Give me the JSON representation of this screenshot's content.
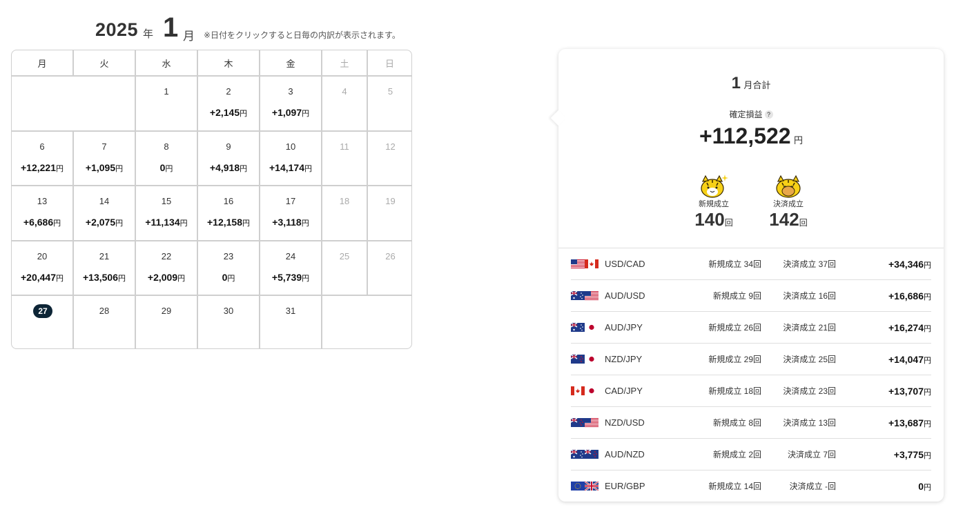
{
  "calendar": {
    "year": "2025",
    "year_unit": "年",
    "month": "1",
    "month_unit": "月",
    "note": "※日付をクリックすると日毎の内訳が表示されます。",
    "weekdays": [
      "月",
      "火",
      "水",
      "木",
      "金",
      "土",
      "日"
    ],
    "currency_unit": "円",
    "weeks": [
      [
        {
          "day": "",
          "pl": ""
        },
        {
          "day": "",
          "pl": ""
        },
        {
          "day": "1",
          "pl": ""
        },
        {
          "day": "2",
          "pl": "+2,145"
        },
        {
          "day": "3",
          "pl": "+1,097"
        },
        {
          "day": "4",
          "pl": ""
        },
        {
          "day": "5",
          "pl": ""
        }
      ],
      [
        {
          "day": "6",
          "pl": "+12,221"
        },
        {
          "day": "7",
          "pl": "+1,095"
        },
        {
          "day": "8",
          "pl": "0"
        },
        {
          "day": "9",
          "pl": "+4,918"
        },
        {
          "day": "10",
          "pl": "+14,174"
        },
        {
          "day": "11",
          "pl": ""
        },
        {
          "day": "12",
          "pl": ""
        }
      ],
      [
        {
          "day": "13",
          "pl": "+6,686"
        },
        {
          "day": "14",
          "pl": "+2,075"
        },
        {
          "day": "15",
          "pl": "+11,134"
        },
        {
          "day": "16",
          "pl": "+12,158"
        },
        {
          "day": "17",
          "pl": "+3,118"
        },
        {
          "day": "18",
          "pl": ""
        },
        {
          "day": "19",
          "pl": ""
        }
      ],
      [
        {
          "day": "20",
          "pl": "+20,447"
        },
        {
          "day": "21",
          "pl": "+13,506"
        },
        {
          "day": "22",
          "pl": "+2,009"
        },
        {
          "day": "23",
          "pl": "0"
        },
        {
          "day": "24",
          "pl": "+5,739"
        },
        {
          "day": "25",
          "pl": ""
        },
        {
          "day": "26",
          "pl": ""
        }
      ],
      [
        {
          "day": "27",
          "pl": "",
          "today": true
        },
        {
          "day": "28",
          "pl": ""
        },
        {
          "day": "29",
          "pl": ""
        },
        {
          "day": "30",
          "pl": ""
        },
        {
          "day": "31",
          "pl": ""
        },
        {
          "day": "",
          "pl": ""
        },
        {
          "day": "",
          "pl": ""
        }
      ]
    ]
  },
  "summary": {
    "month": "1",
    "title_suffix": "月合計",
    "realized_label": "確定損益",
    "help_glyph": "?",
    "total": "+112,522",
    "unit": "円",
    "open_label": "新規成立",
    "open_count": "140",
    "close_label": "決済成立",
    "close_count": "142",
    "count_unit": "回",
    "pairs": [
      {
        "name": "USD/CAD",
        "flags": [
          "us",
          "ca"
        ],
        "open": "新規成立 34回",
        "close": "決済成立 37回",
        "pl": "+34,346"
      },
      {
        "name": "AUD/USD",
        "flags": [
          "au",
          "us"
        ],
        "open": "新規成立 9回",
        "close": "決済成立 16回",
        "pl": "+16,686"
      },
      {
        "name": "AUD/JPY",
        "flags": [
          "au",
          "jp"
        ],
        "open": "新規成立 26回",
        "close": "決済成立 21回",
        "pl": "+16,274"
      },
      {
        "name": "NZD/JPY",
        "flags": [
          "nz",
          "jp"
        ],
        "open": "新規成立 29回",
        "close": "決済成立 25回",
        "pl": "+14,047"
      },
      {
        "name": "CAD/JPY",
        "flags": [
          "ca",
          "jp"
        ],
        "open": "新規成立 18回",
        "close": "決済成立 23回",
        "pl": "+13,707"
      },
      {
        "name": "NZD/USD",
        "flags": [
          "nz",
          "us"
        ],
        "open": "新規成立 8回",
        "close": "決済成立 13回",
        "pl": "+13,687"
      },
      {
        "name": "AUD/NZD",
        "flags": [
          "au",
          "nz"
        ],
        "open": "新規成立 2回",
        "close": "決済成立 7回",
        "pl": "+3,775"
      },
      {
        "name": "EUR/GBP",
        "flags": [
          "eu",
          "gb"
        ],
        "open": "新規成立 14回",
        "close": "決済成立 -回",
        "pl": "0"
      }
    ]
  }
}
